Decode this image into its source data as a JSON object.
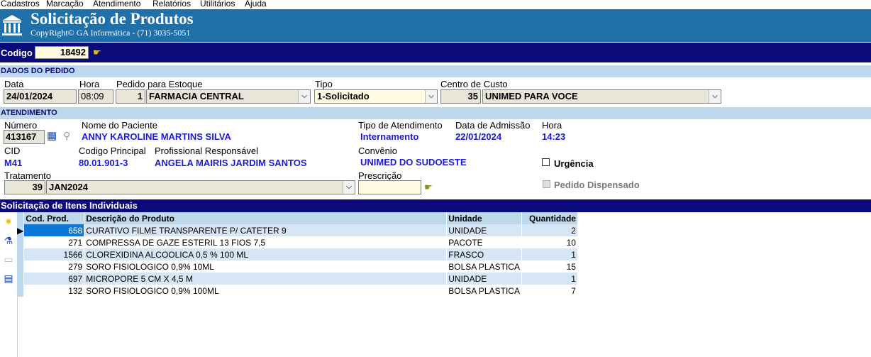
{
  "menu": [
    "Cadastros",
    "Marcação",
    "Atendimento",
    "Relatórios",
    "Utilitários",
    "Ajuda"
  ],
  "header": {
    "title": "Solicitação de Produtos",
    "subtitle": "CopyRight© GA Informática - (71) 3035-5051"
  },
  "codigo": {
    "label": "Codigo",
    "value": "18492"
  },
  "dados_pedido": {
    "section": "DADOS DO PEDIDO",
    "data_label": "Data",
    "data_value": "24/01/2024",
    "hora_label": "Hora",
    "hora_value": "08:09",
    "estoque_label": "Pedido para Estoque",
    "estoque_code": "1",
    "estoque_name": "FARMACIA CENTRAL",
    "tipo_label": "Tipo",
    "tipo_value": "1-Solicitado",
    "centro_label": "Centro de Custo",
    "centro_code": "35",
    "centro_name": "UNIMED PARA VOCE"
  },
  "atendimento": {
    "section": "ATENDIMENTO",
    "numero_label": "Número",
    "numero_value": "413167",
    "paciente_label": "Nome do Paciente",
    "paciente_value": "ANNY KAROLINE MARTINS SILVA",
    "tipo_atend_label": "Tipo de Atendimento",
    "tipo_atend_value": "Internamento",
    "admissao_label": "Data de Admissão",
    "admissao_value": "22/01/2024",
    "hora_label": "Hora",
    "hora_value": "14:23",
    "cid_label": "CID",
    "cid_value": "M41",
    "codprinc_label": "Codigo Principal",
    "codprinc_value": "80.01.901-3",
    "prof_label": "Profissional Responsável",
    "prof_value": "ANGELA MAIRIS JARDIM SANTOS",
    "convenio_label": "Convênio",
    "convenio_value": "UNIMED DO SUDOESTE",
    "urgencia_label": "Urgência",
    "tratamento_label": "Tratamento",
    "tratamento_code": "39",
    "tratamento_name": "JAN2024",
    "prescricao_label": "Prescrição",
    "prescricao_value": "",
    "dispensado_label": "Pedido Dispensado"
  },
  "itens": {
    "section": "Solicitação de Itens Individuais",
    "columns": [
      "Cod. Prod.",
      "Descrição do Produto",
      "Unidade",
      "Quantidade"
    ],
    "rows": [
      [
        "658",
        "CURATIVO FILME TRANSPARENTE P/ CATETER 9",
        "UNIDADE",
        "2"
      ],
      [
        "271",
        "COMPRESSA DE GAZE ESTERIL 13 FIOS 7,5",
        "PACOTE",
        "10"
      ],
      [
        "1566",
        "CLOREXIDINA ALCOOLICA 0,5 % 100 ML",
        "FRASCO",
        "1"
      ],
      [
        "279",
        "SORO FISIOLOGICO 0,9% 10ML",
        "BOLSA PLASTICA",
        "15"
      ],
      [
        "697",
        "MICROPORE  5 CM X 4,5 M",
        "UNIDADE",
        "1"
      ],
      [
        "132",
        "SORO FISIOLOGICO 0,9% 100ML",
        "BOLSA PLASTICA",
        "7"
      ]
    ]
  }
}
